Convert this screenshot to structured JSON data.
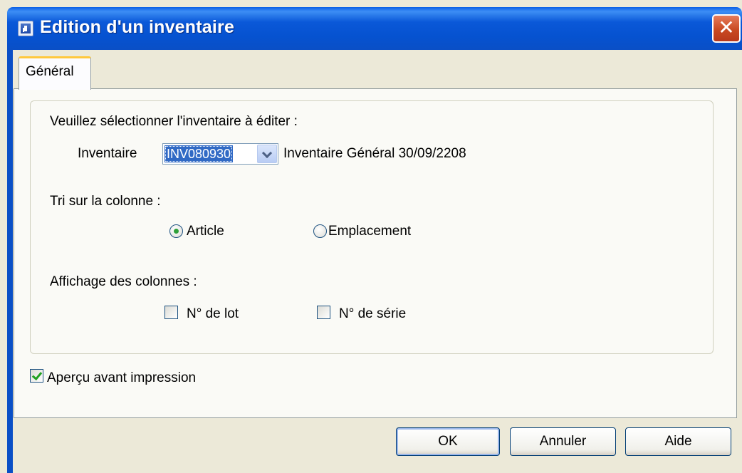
{
  "window": {
    "title": "Edition d'un inventaire",
    "close_glyph": "✕"
  },
  "tabs": [
    {
      "label": "Général",
      "active": true
    }
  ],
  "form": {
    "select_prompt": "Veuillez sélectionner l'inventaire à éditer :",
    "inventory_label": "Inventaire",
    "inventory_value": "INV080930",
    "inventory_description": "Inventaire Général 30/09/2208",
    "sort_prompt": "Tri sur la colonne :",
    "sort_options": [
      {
        "label": "Article",
        "checked": true
      },
      {
        "label": "Emplacement",
        "checked": false
      }
    ],
    "columns_prompt": "Affichage des colonnes :",
    "column_options": [
      {
        "label": "N° de lot",
        "checked": false
      },
      {
        "label": "N° de série",
        "checked": false
      }
    ],
    "preview_label": "Aperçu avant impression",
    "preview_checked": true
  },
  "buttons": {
    "ok": "OK",
    "cancel": "Annuler",
    "help": "Aide"
  },
  "colors": {
    "titlebar": "#0a58d8",
    "selection": "#316ac5",
    "tab_highlight": "#ffc83c",
    "check_green": "#21a121"
  }
}
